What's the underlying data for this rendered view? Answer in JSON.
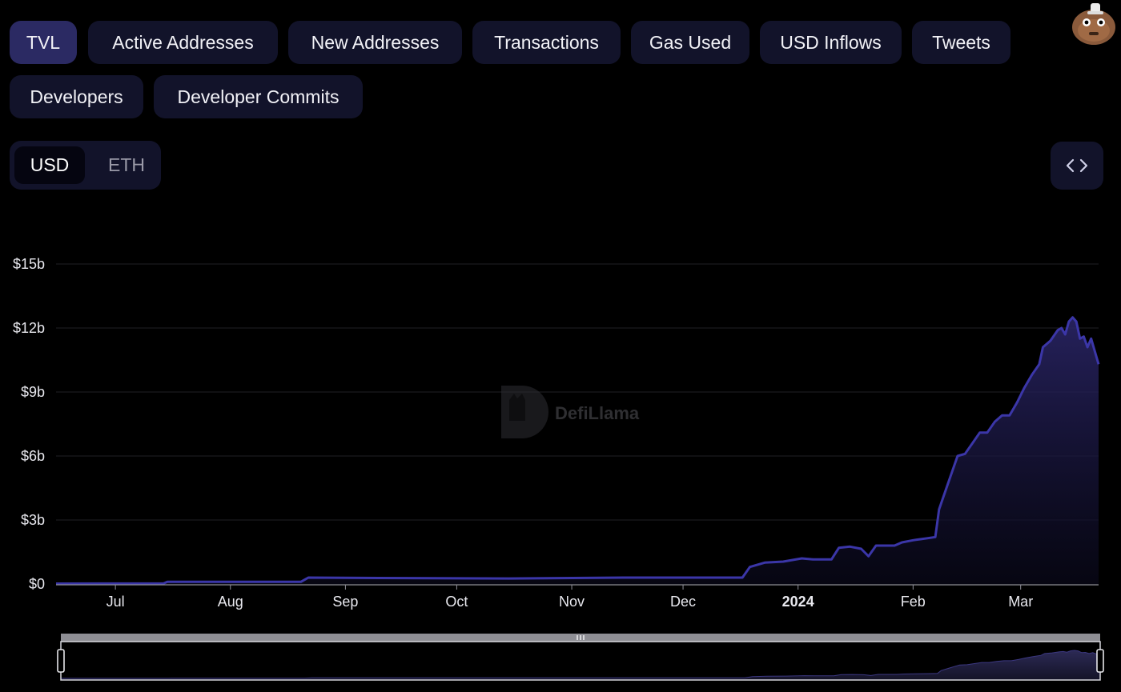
{
  "tabs": [
    {
      "label": "TVL",
      "active": true,
      "name": "tab-tvl"
    },
    {
      "label": "Active Addresses",
      "active": false,
      "name": "tab-active-addresses"
    },
    {
      "label": "New Addresses",
      "active": false,
      "name": "tab-new-addresses"
    },
    {
      "label": "Transactions",
      "active": false,
      "name": "tab-transactions"
    },
    {
      "label": "Gas Used",
      "active": false,
      "name": "tab-gas-used"
    },
    {
      "label": "USD Inflows",
      "active": false,
      "name": "tab-usd-inflows"
    },
    {
      "label": "Tweets",
      "active": false,
      "name": "tab-tweets"
    },
    {
      "label": "Developers",
      "active": false,
      "name": "tab-developers"
    },
    {
      "label": "Developer Commits",
      "active": false,
      "name": "tab-developer-commits"
    }
  ],
  "currency": {
    "usd": "USD",
    "eth": "ETH",
    "selected": "USD"
  },
  "watermark": "DefiLlama",
  "icons": {
    "embed": "code-icon",
    "avatar": "llama-avatar-icon",
    "logo": "defillama-logo-icon"
  },
  "colors": {
    "accent": "#3b36a8",
    "line": "#3b36a8",
    "background": "#000000",
    "pill": "#12132a",
    "pill_active": "#2b2a63"
  },
  "chart_data": {
    "type": "area",
    "title": "",
    "xlabel": "",
    "ylabel": "",
    "ylim": [
      0,
      15
    ],
    "y_unit": "b",
    "yticks": [
      "$0",
      "$3b",
      "$6b",
      "$9b",
      "$12b",
      "$15b"
    ],
    "ytick_values": [
      0,
      3,
      6,
      9,
      12,
      15
    ],
    "xticks": [
      {
        "label": "Jul",
        "date": "2023-07-01",
        "bold": false
      },
      {
        "label": "Aug",
        "date": "2023-08-01",
        "bold": false
      },
      {
        "label": "Sep",
        "date": "2023-09-01",
        "bold": false
      },
      {
        "label": "Oct",
        "date": "2023-10-01",
        "bold": false
      },
      {
        "label": "Nov",
        "date": "2023-11-01",
        "bold": false
      },
      {
        "label": "Dec",
        "date": "2023-12-01",
        "bold": false
      },
      {
        "label": "2024",
        "date": "2024-01-01",
        "bold": true
      },
      {
        "label": "Feb",
        "date": "2024-02-01",
        "bold": false
      },
      {
        "label": "Mar",
        "date": "2024-03-01",
        "bold": false
      }
    ],
    "grid": true,
    "legend": "none",
    "series": [
      {
        "points": [
          [
            "2023-06-15",
            0.02
          ],
          [
            "2023-07-14",
            0.03
          ],
          [
            "2023-07-15",
            0.1
          ],
          [
            "2023-08-20",
            0.1
          ],
          [
            "2023-08-22",
            0.3
          ],
          [
            "2023-09-10",
            0.28
          ],
          [
            "2023-10-15",
            0.26
          ],
          [
            "2023-11-15",
            0.3
          ],
          [
            "2023-12-10",
            0.3
          ],
          [
            "2023-12-17",
            0.3
          ],
          [
            "2023-12-19",
            0.8
          ],
          [
            "2023-12-23",
            1.0
          ],
          [
            "2023-12-28",
            1.05
          ],
          [
            "2024-01-02",
            1.2
          ],
          [
            "2024-01-05",
            1.15
          ],
          [
            "2024-01-10",
            1.15
          ],
          [
            "2024-01-12",
            1.7
          ],
          [
            "2024-01-15",
            1.75
          ],
          [
            "2024-01-18",
            1.65
          ],
          [
            "2024-01-20",
            1.3
          ],
          [
            "2024-01-22",
            1.8
          ],
          [
            "2024-01-27",
            1.8
          ],
          [
            "2024-01-29",
            1.95
          ],
          [
            "2024-02-01",
            2.05
          ],
          [
            "2024-02-03",
            2.1
          ],
          [
            "2024-02-05",
            2.15
          ],
          [
            "2024-02-07",
            2.2
          ],
          [
            "2024-02-08",
            3.5
          ],
          [
            "2024-02-10",
            4.5
          ],
          [
            "2024-02-13",
            6.0
          ],
          [
            "2024-02-15",
            6.1
          ],
          [
            "2024-02-17",
            6.6
          ],
          [
            "2024-02-19",
            7.1
          ],
          [
            "2024-02-21",
            7.1
          ],
          [
            "2024-02-23",
            7.6
          ],
          [
            "2024-02-25",
            7.9
          ],
          [
            "2024-02-27",
            7.9
          ],
          [
            "2024-02-29",
            8.5
          ],
          [
            "2024-03-02",
            9.2
          ],
          [
            "2024-03-04",
            9.8
          ],
          [
            "2024-03-06",
            10.3
          ],
          [
            "2024-03-07",
            11.1
          ],
          [
            "2024-03-09",
            11.4
          ],
          [
            "2024-03-11",
            11.9
          ],
          [
            "2024-03-12",
            12.0
          ],
          [
            "2024-03-13",
            11.7
          ],
          [
            "2024-03-14",
            12.3
          ],
          [
            "2024-03-15",
            12.5
          ],
          [
            "2024-03-16",
            12.3
          ],
          [
            "2024-03-17",
            11.5
          ],
          [
            "2024-03-18",
            11.6
          ],
          [
            "2024-03-19",
            11.1
          ],
          [
            "2024-03-20",
            11.5
          ],
          [
            "2024-03-22",
            10.3
          ]
        ]
      }
    ]
  }
}
